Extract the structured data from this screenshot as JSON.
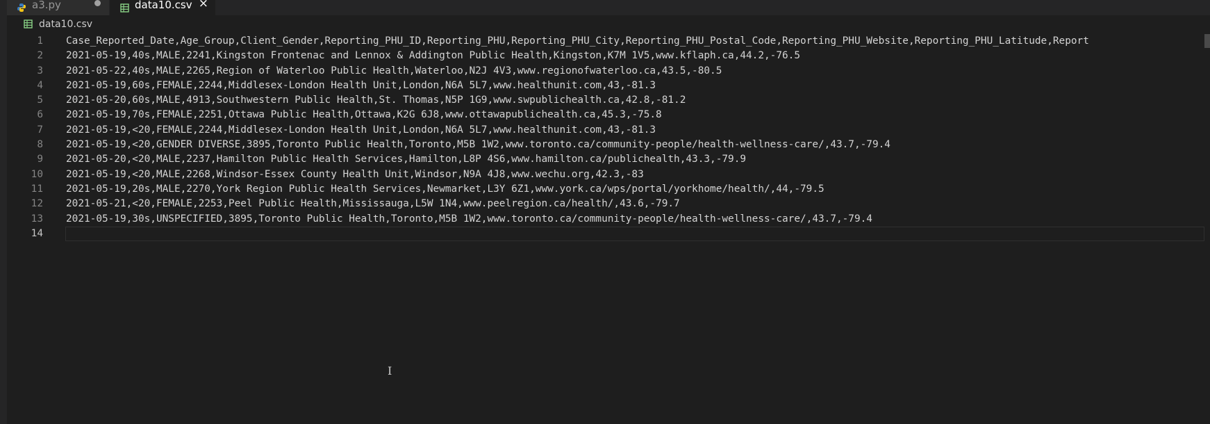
{
  "tabs": [
    {
      "label": "a3.py",
      "icon": "python-icon",
      "dirty": true
    },
    {
      "label": "data10.csv",
      "icon": "csv-table-icon",
      "active": true
    }
  ],
  "breadcrumb": {
    "file": "data10.csv",
    "icon": "csv-table-icon"
  },
  "editor": {
    "lines": [
      {
        "num": "1",
        "text": "Case_Reported_Date,Age_Group,Client_Gender,Reporting_PHU_ID,Reporting_PHU,Reporting_PHU_City,Reporting_PHU_Postal_Code,Reporting_PHU_Website,Reporting_PHU_Latitude,Report"
      },
      {
        "num": "2",
        "text": "2021-05-19,40s,MALE,2241,Kingston Frontenac and Lennox & Addington Public Health,Kingston,K7M 1V5,www.kflaph.ca,44.2,-76.5"
      },
      {
        "num": "3",
        "text": "2021-05-22,40s,MALE,2265,Region of Waterloo Public Health,Waterloo,N2J 4V3,www.regionofwaterloo.ca,43.5,-80.5"
      },
      {
        "num": "4",
        "text": "2021-05-19,60s,FEMALE,2244,Middlesex-London Health Unit,London,N6A 5L7,www.healthunit.com,43,-81.3"
      },
      {
        "num": "5",
        "text": "2021-05-20,60s,MALE,4913,Southwestern Public Health,St. Thomas,N5P 1G9,www.swpublichealth.ca,42.8,-81.2"
      },
      {
        "num": "6",
        "text": "2021-05-19,70s,FEMALE,2251,Ottawa Public Health,Ottawa,K2G 6J8,www.ottawapublichealth.ca,45.3,-75.8"
      },
      {
        "num": "7",
        "text": "2021-05-19,<20,FEMALE,2244,Middlesex-London Health Unit,London,N6A 5L7,www.healthunit.com,43,-81.3"
      },
      {
        "num": "8",
        "text": "2021-05-19,<20,GENDER DIVERSE,3895,Toronto Public Health,Toronto,M5B 1W2,www.toronto.ca/community-people/health-wellness-care/,43.7,-79.4"
      },
      {
        "num": "9",
        "text": "2021-05-20,<20,MALE,2237,Hamilton Public Health Services,Hamilton,L8P 4S6,www.hamilton.ca/publichealth,43.3,-79.9"
      },
      {
        "num": "10",
        "text": "2021-05-19,<20,MALE,2268,Windsor-Essex County Health Unit,Windsor,N9A 4J8,www.wechu.org,42.3,-83"
      },
      {
        "num": "11",
        "text": "2021-05-19,20s,MALE,2270,York Region Public Health Services,Newmarket,L3Y 6Z1,www.york.ca/wps/portal/yorkhome/health/,44,-79.5"
      },
      {
        "num": "12",
        "text": "2021-05-21,<20,FEMALE,2253,Peel Public Health,Mississauga,L5W 1N4,www.peelregion.ca/health/,43.6,-79.7"
      },
      {
        "num": "13",
        "text": "2021-05-19,30s,UNSPECIFIED,3895,Toronto Public Health,Toronto,M5B 1W2,www.toronto.ca/community-people/health-wellness-care/,43.7,-79.4"
      },
      {
        "num": "14",
        "text": ""
      }
    ],
    "current_line": 14
  },
  "colors": {
    "editor_bg": "#1e1e1e",
    "tabbar_bg": "#252526",
    "text": "#d4d4d4",
    "line_number": "#858585",
    "csv_icon": "#89d185",
    "python_icon": "#3b7bbf"
  }
}
